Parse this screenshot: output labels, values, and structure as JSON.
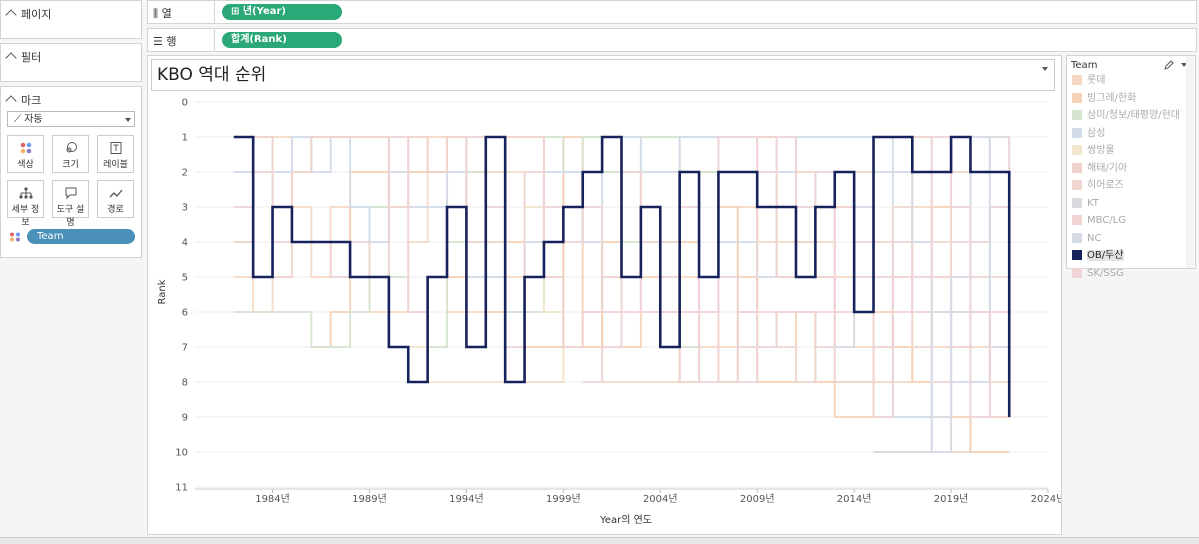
{
  "sidebar": {
    "pages_label": "페이지",
    "filters_label": "필터",
    "marks_label": "마크",
    "mark_type": "자동",
    "mark_buttons": [
      {
        "label": "색상",
        "icon": "color-icon"
      },
      {
        "label": "크기",
        "icon": "size-icon"
      },
      {
        "label": "레이블",
        "icon": "label-icon"
      },
      {
        "label": "세부 정보",
        "icon": "detail-icon"
      },
      {
        "label": "도구 설명",
        "icon": "tooltip-icon"
      },
      {
        "label": "경로",
        "icon": "path-icon"
      }
    ],
    "color_field": "Team"
  },
  "shelves": {
    "columns_label": "열",
    "columns_pill": "⊞ 년(Year)",
    "rows_label": "행",
    "rows_pill": "합계(Rank)"
  },
  "legend": {
    "title": "Team",
    "items": [
      {
        "name": "롯데",
        "color": "#f5d9c4",
        "selected": false
      },
      {
        "name": "빙그레/한화",
        "color": "#f5d2b8",
        "selected": false
      },
      {
        "name": "삼미/청보/태평양/현대",
        "color": "#d6e3cf",
        "selected": false
      },
      {
        "name": "삼성",
        "color": "#d3dce8",
        "selected": false
      },
      {
        "name": "쌍방울",
        "color": "#f2e6cc",
        "selected": false
      },
      {
        "name": "해태/기아",
        "color": "#f0d2cc",
        "selected": false
      },
      {
        "name": "히어로즈",
        "color": "#f0d8d0",
        "selected": false
      },
      {
        "name": "KT",
        "color": "#d9d9de",
        "selected": false
      },
      {
        "name": "MBC/LG",
        "color": "#f0d4d4",
        "selected": false
      },
      {
        "name": "NC",
        "color": "#d4dbe6",
        "selected": false
      },
      {
        "name": "OB/두산",
        "color": "#16225c",
        "selected": true
      },
      {
        "name": "SK/SSG",
        "color": "#efd4d8",
        "selected": false
      }
    ]
  },
  "chart_data": {
    "type": "line",
    "title": "KBO 역대 순위",
    "xlabel": "Year의 연도",
    "ylabel": "Rank",
    "xlim": [
      1980,
      2024
    ],
    "ylim": [
      11,
      0
    ],
    "x_ticks": [
      1984,
      1989,
      1994,
      1999,
      2004,
      2009,
      2014,
      2019,
      2024
    ],
    "x_tick_labels": [
      "1984년",
      "1989년",
      "1994년",
      "1999년",
      "2004년",
      "2009년",
      "2014년",
      "2019년",
      "2024년"
    ],
    "y_ticks": [
      0,
      1,
      2,
      3,
      4,
      5,
      6,
      7,
      8,
      9,
      10,
      11
    ],
    "step": true,
    "highlighted": "OB/두산",
    "series": [
      {
        "name": "OB/두산",
        "color": "#16225c",
        "x": [
          1982,
          1983,
          1984,
          1985,
          1986,
          1987,
          1988,
          1989,
          1990,
          1991,
          1992,
          1993,
          1994,
          1995,
          1996,
          1997,
          1998,
          1999,
          2000,
          2001,
          2002,
          2003,
          2004,
          2005,
          2006,
          2007,
          2008,
          2009,
          2010,
          2011,
          2012,
          2013,
          2014,
          2015,
          2016,
          2017,
          2018,
          2019,
          2020,
          2021,
          2022
        ],
        "values": [
          1,
          5,
          3,
          4,
          4,
          4,
          5,
          5,
          7,
          8,
          5,
          3,
          7,
          1,
          8,
          5,
          4,
          3,
          2,
          1,
          5,
          3,
          7,
          2,
          5,
          2,
          2,
          3,
          3,
          5,
          3,
          2,
          6,
          1,
          1,
          2,
          2,
          1,
          2,
          2,
          9
        ]
      },
      {
        "name": "롯데",
        "color": "#f5d9c4",
        "x": [
          1982,
          1983,
          1984,
          1985,
          1986,
          1987,
          1988,
          1989,
          1990,
          1991,
          1992,
          1993,
          1994,
          1995,
          1996,
          1997,
          1998,
          1999,
          2000,
          2001,
          2002,
          2003,
          2004,
          2005,
          2006,
          2007,
          2008,
          2009,
          2010,
          2011,
          2012,
          2013,
          2014,
          2015,
          2016,
          2017,
          2018,
          2019,
          2020,
          2021,
          2022
        ],
        "values": [
          5,
          6,
          1,
          3,
          5,
          3,
          5,
          6,
          6,
          4,
          1,
          6,
          6,
          2,
          5,
          8,
          8,
          2,
          4,
          8,
          8,
          8,
          8,
          5,
          7,
          7,
          3,
          4,
          4,
          2,
          4,
          5,
          7,
          8,
          8,
          3,
          7,
          10,
          7,
          8,
          8
        ]
      },
      {
        "name": "빙그레/한화",
        "color": "#f5d2b8",
        "x": [
          1986,
          1987,
          1988,
          1989,
          1990,
          1991,
          1992,
          1993,
          1994,
          1995,
          1996,
          1997,
          1998,
          1999,
          2000,
          2001,
          2002,
          2003,
          2004,
          2005,
          2006,
          2007,
          2008,
          2009,
          2010,
          2011,
          2012,
          2013,
          2014,
          2015,
          2016,
          2017,
          2018,
          2019,
          2020,
          2021,
          2022
        ],
        "values": [
          7,
          6,
          2,
          2,
          2,
          2,
          2,
          5,
          2,
          6,
          4,
          7,
          7,
          1,
          7,
          4,
          7,
          5,
          7,
          4,
          2,
          3,
          5,
          8,
          8,
          6,
          8,
          9,
          9,
          6,
          7,
          8,
          3,
          9,
          10,
          10,
          10
        ]
      },
      {
        "name": "삼미/청보/태평양/현대",
        "color": "#d6e3cf",
        "x": [
          1982,
          1983,
          1984,
          1985,
          1986,
          1987,
          1988,
          1989,
          1990,
          1991,
          1992,
          1993,
          1994,
          1995,
          1996,
          1997,
          1998,
          1999,
          2000,
          2001,
          2002,
          2003,
          2004,
          2005,
          2006,
          2007
        ],
        "values": [
          6,
          6,
          6,
          6,
          7,
          7,
          6,
          3,
          5,
          6,
          7,
          4,
          2,
          5,
          2,
          6,
          1,
          2,
          1,
          2,
          4,
          1,
          1,
          7,
          2,
          6
        ]
      },
      {
        "name": "삼성",
        "color": "#d3dce8",
        "x": [
          1982,
          1983,
          1984,
          1985,
          1986,
          1987,
          1988,
          1989,
          1990,
          1991,
          1992,
          1993,
          1994,
          1995,
          1996,
          1997,
          1998,
          1999,
          2000,
          2001,
          2002,
          2003,
          2004,
          2005,
          2006,
          2007,
          2008,
          2009,
          2010,
          2011,
          2012,
          2013,
          2014,
          2015,
          2016,
          2017,
          2018,
          2019,
          2020,
          2021,
          2022
        ],
        "values": [
          2,
          5,
          2,
          1,
          2,
          1,
          3,
          4,
          2,
          3,
          3,
          2,
          5,
          5,
          6,
          4,
          2,
          2,
          4,
          1,
          1,
          2,
          2,
          1,
          1,
          4,
          4,
          5,
          2,
          1,
          1,
          1,
          1,
          1,
          9,
          9,
          6,
          8,
          8,
          3,
          7
        ]
      },
      {
        "name": "쌍방울",
        "color": "#f2e6cc",
        "x": [
          1991,
          1992,
          1993,
          1994,
          1995,
          1996,
          1997,
          1998,
          1999
        ],
        "values": [
          7,
          8,
          8,
          8,
          8,
          2,
          3,
          6,
          8
        ]
      },
      {
        "name": "해태/기아",
        "color": "#f0d2cc",
        "x": [
          1982,
          1983,
          1984,
          1985,
          1986,
          1987,
          1988,
          1989,
          1990,
          1991,
          1992,
          1993,
          1994,
          1995,
          1996,
          1997,
          1998,
          1999,
          2000,
          2001,
          2002,
          2003,
          2004,
          2005,
          2006,
          2007,
          2008,
          2009,
          2010,
          2011,
          2012,
          2013,
          2014,
          2015,
          2016,
          2017,
          2018,
          2019,
          2020,
          2021,
          2022
        ],
        "values": [
          4,
          1,
          5,
          2,
          1,
          1,
          1,
          1,
          3,
          1,
          2,
          1,
          4,
          4,
          1,
          1,
          5,
          7,
          6,
          5,
          2,
          4,
          4,
          8,
          5,
          8,
          6,
          1,
          5,
          4,
          5,
          8,
          8,
          7,
          5,
          1,
          5,
          7,
          6,
          9,
          5
        ]
      },
      {
        "name": "히어로즈",
        "color": "#f0d8d0",
        "x": [
          2008,
          2009,
          2010,
          2011,
          2012,
          2013,
          2014,
          2015,
          2016,
          2017,
          2018,
          2019,
          2020,
          2021,
          2022
        ],
        "values": [
          7,
          6,
          7,
          8,
          6,
          3,
          2,
          4,
          3,
          7,
          4,
          2,
          5,
          5,
          2
        ]
      },
      {
        "name": "KT",
        "color": "#d9d9de",
        "x": [
          2015,
          2016,
          2017,
          2018,
          2019,
          2020,
          2021,
          2022
        ],
        "values": [
          10,
          10,
          10,
          9,
          6,
          2,
          1,
          4
        ]
      },
      {
        "name": "MBC/LG",
        "color": "#f0d4d4",
        "x": [
          1982,
          1983,
          1984,
          1985,
          1986,
          1987,
          1988,
          1989,
          1990,
          1991,
          1992,
          1993,
          1994,
          1995,
          1996,
          1997,
          1998,
          1999,
          2000,
          2001,
          2002,
          2003,
          2004,
          2005,
          2006,
          2007,
          2008,
          2009,
          2010,
          2011,
          2012,
          2013,
          2014,
          2015,
          2016,
          2017,
          2018,
          2019,
          2020,
          2021,
          2022
        ],
        "values": [
          3,
          2,
          4,
          4,
          4,
          5,
          4,
          5,
          1,
          6,
          5,
          3,
          1,
          3,
          7,
          2,
          3,
          4,
          3,
          6,
          2,
          6,
          6,
          6,
          8,
          5,
          8,
          7,
          6,
          6,
          7,
          3,
          4,
          9,
          4,
          6,
          8,
          4,
          4,
          3,
          2
        ]
      },
      {
        "name": "NC",
        "color": "#d4dbe6",
        "x": [
          2013,
          2014,
          2015,
          2016,
          2017,
          2018,
          2019,
          2020,
          2021,
          2022
        ],
        "values": [
          7,
          3,
          2,
          2,
          4,
          10,
          5,
          1,
          7,
          6
        ]
      },
      {
        "name": "SK/SSG",
        "color": "#efd4d8",
        "x": [
          2000,
          2001,
          2002,
          2003,
          2004,
          2005,
          2006,
          2007,
          2008,
          2009,
          2010,
          2011,
          2012,
          2013,
          2014,
          2015,
          2016,
          2017,
          2018,
          2019,
          2020,
          2021,
          2022
        ],
        "values": [
          8,
          7,
          6,
          3,
          5,
          3,
          6,
          1,
          1,
          2,
          1,
          3,
          2,
          6,
          5,
          5,
          6,
          5,
          1,
          3,
          9,
          6,
          1
        ]
      }
    ]
  }
}
